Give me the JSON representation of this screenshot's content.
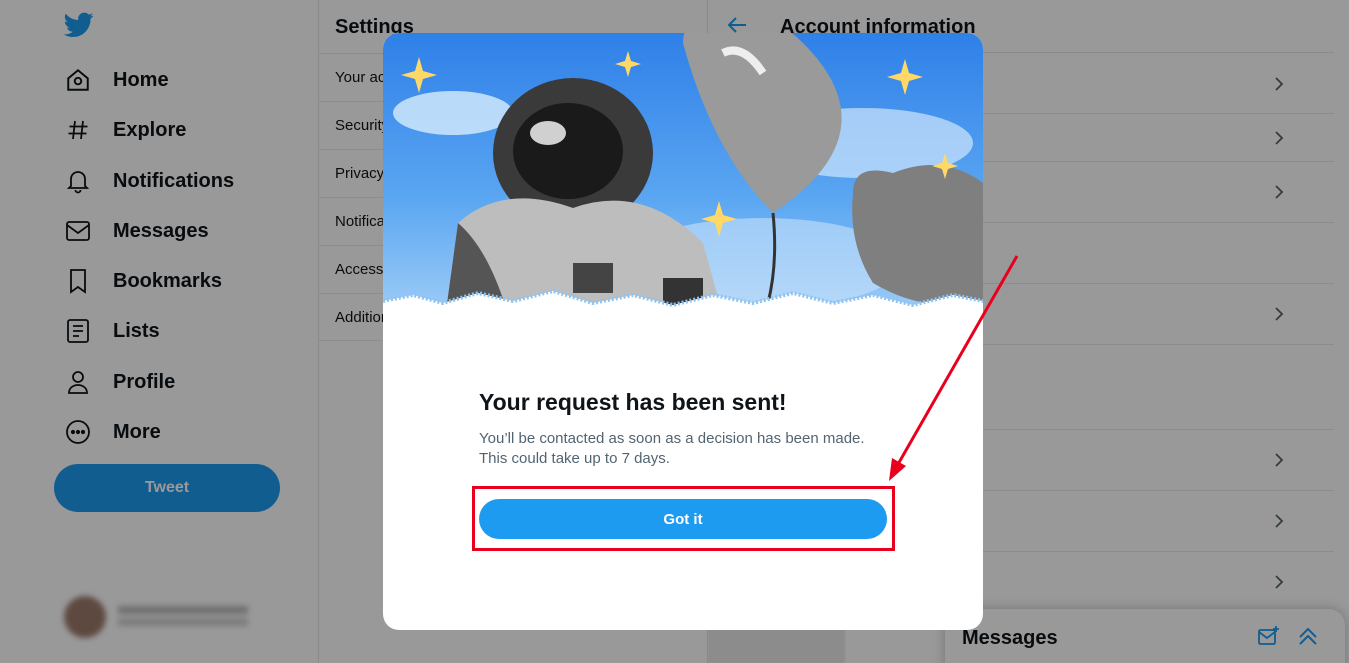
{
  "nav": {
    "items": [
      {
        "label": "Home",
        "icon": "home-icon"
      },
      {
        "label": "Explore",
        "icon": "hashtag-icon"
      },
      {
        "label": "Notifications",
        "icon": "bell-icon"
      },
      {
        "label": "Messages",
        "icon": "envelope-icon"
      },
      {
        "label": "Bookmarks",
        "icon": "bookmark-icon"
      },
      {
        "label": "Lists",
        "icon": "list-icon"
      },
      {
        "label": "Profile",
        "icon": "person-icon"
      },
      {
        "label": "More",
        "icon": "more-circle-icon"
      }
    ],
    "tweet_label": "Tweet"
  },
  "settings": {
    "title": "Settings",
    "rows": [
      "Your account",
      "Security and account access",
      "Privacy and safety",
      "Notifications",
      "Accessibility, display, and languages",
      "Additional resources"
    ]
  },
  "detail": {
    "title": "Account information"
  },
  "messages_drawer": {
    "title": "Messages"
  },
  "modal": {
    "title": "Your request has been sent!",
    "body": "You’ll be contacted as soon as a decision has been made. This could take up to 7 days.",
    "button_label": "Got it"
  },
  "colors": {
    "accent": "#1d9bf0",
    "annotation": "#e8001c"
  }
}
